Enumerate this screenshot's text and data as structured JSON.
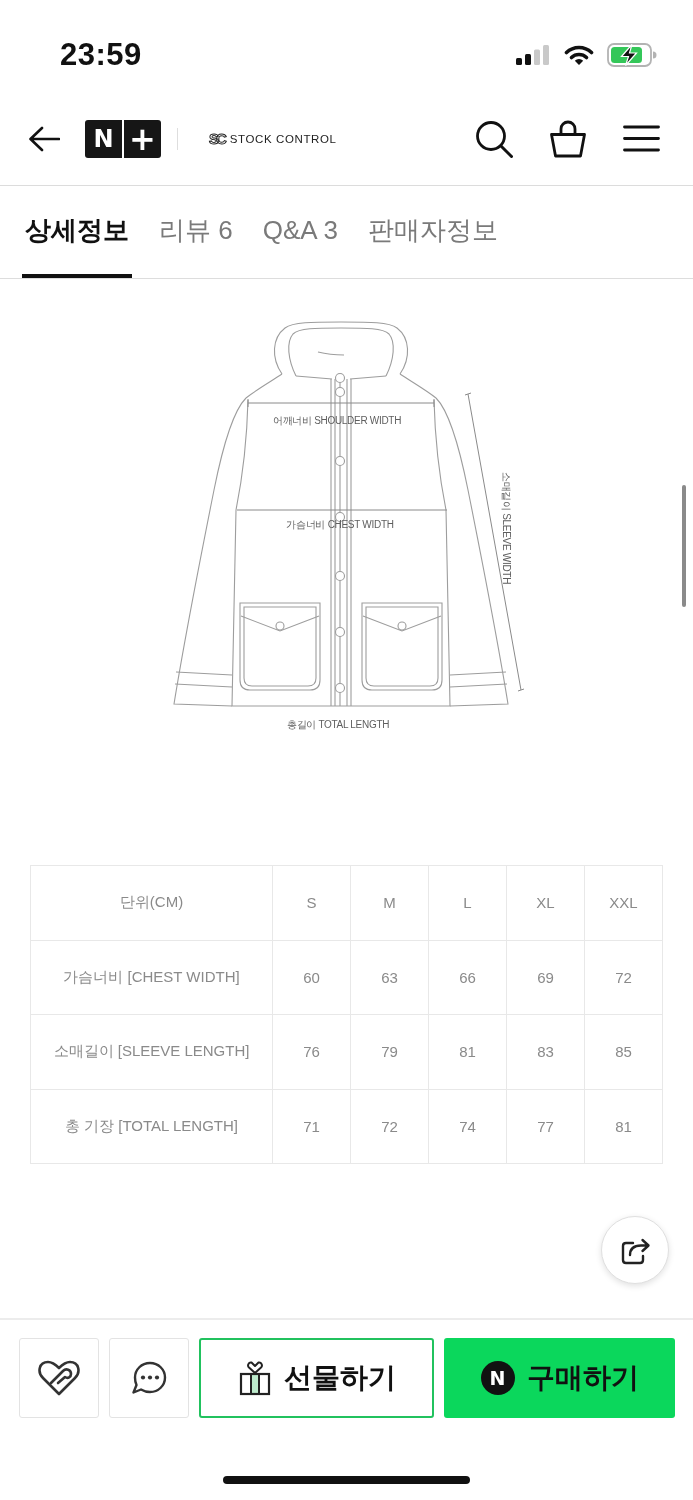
{
  "status_bar": {
    "time": "23:59"
  },
  "header": {
    "logo": [
      "N",
      "+"
    ],
    "store": {
      "mark": "SC",
      "name": "STOCK CONTROL"
    }
  },
  "tabs": [
    {
      "label": "상세정보",
      "selected": true
    },
    {
      "label": "리뷰 6",
      "selected": false
    },
    {
      "label": "Q&A 3",
      "selected": false
    },
    {
      "label": "판매자정보",
      "selected": false
    }
  ],
  "size_diagram": {
    "labels": [
      {
        "kind": "shoulder",
        "text": "어깨너비 SHOULDER WIDTH"
      },
      {
        "kind": "chest",
        "text": "가슴너비 CHEST WIDTH"
      },
      {
        "kind": "sleeve",
        "text": "소매길이 SLEEVE WIDTH"
      },
      {
        "kind": "length",
        "text": "총길이 TOTAL LENGTH"
      }
    ]
  },
  "size_table": {
    "columns": [
      "단위(CM)",
      "S",
      "M",
      "L",
      "XL",
      "XXL"
    ],
    "rows": [
      [
        "가슴너비 [CHEST WIDTH]",
        "60",
        "63",
        "66",
        "69",
        "72"
      ],
      [
        "소매길이 [SLEEVE LENGTH]",
        "76",
        "79",
        "81",
        "83",
        "85"
      ],
      [
        "총 기장 [TOTAL LENGTH]",
        "71",
        "72",
        "74",
        "77",
        "81"
      ]
    ]
  },
  "bottom_bar": {
    "buttons": [
      {
        "kind": "wish"
      },
      {
        "kind": "chat"
      },
      {
        "kind": "gift",
        "label": "선물하기"
      },
      {
        "kind": "buy",
        "badge": "N",
        "label": "구매하기"
      }
    ]
  }
}
